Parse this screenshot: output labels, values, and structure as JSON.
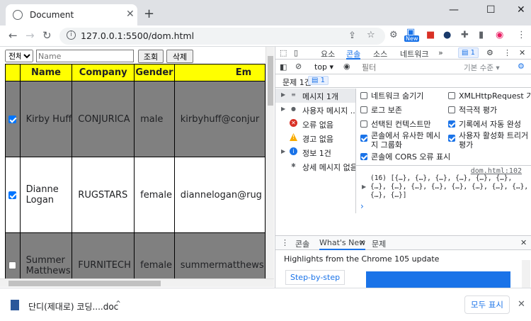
{
  "browser": {
    "tab_title": "Document",
    "tab_close": "✕",
    "new_tab": "+",
    "url": "127.0.0.1:5500/dom.html",
    "new_badge": "New",
    "window_controls": {
      "minimize": "—",
      "maximize": "☐",
      "close": "✕"
    }
  },
  "page": {
    "filter_select": "전체",
    "name_placeholder": "Name",
    "search_button": "조회",
    "delete_button": "삭제",
    "table": {
      "headers": [
        "",
        "Name",
        "Company",
        "Gender",
        "Em"
      ],
      "rows": [
        {
          "checked": true,
          "name": "Kirby Huff",
          "company": "CONJURICA",
          "gender": "male",
          "email": "kirbyhuff@conjur",
          "style": "gray"
        },
        {
          "checked": true,
          "name": "Dianne Logan",
          "company": "RUGSTARS",
          "gender": "female",
          "email": "diannelogan@rug",
          "style": "white"
        },
        {
          "checked": false,
          "name": "Summer Matthews",
          "company": "FURNITECH",
          "gender": "female",
          "email": "summermatthews",
          "style": "gray"
        }
      ]
    }
  },
  "devtools": {
    "tabs": [
      "요소",
      "콘솔",
      "소스",
      "네트워크",
      "»"
    ],
    "active_tab": "콘솔",
    "issue_count": "1",
    "context": "top ▾",
    "filter_placeholder": "필터",
    "level": "기본 수준 ▾",
    "issues_label": "문제 1건:",
    "issues_badge": "1",
    "sidebar": [
      {
        "label": "메시지 1개",
        "icon": "list-icon",
        "color": "#5f6368",
        "glyph": "≡"
      },
      {
        "label": "사용자 메시지 ...",
        "icon": "user-icon",
        "color": "#5f6368",
        "glyph": "●"
      },
      {
        "label": "오류 없음",
        "icon": "error-icon",
        "color": "#d93025",
        "glyph": "✕"
      },
      {
        "label": "경고 없음",
        "icon": "warning-icon",
        "color": "#f9ab00",
        "glyph": "!"
      },
      {
        "label": "정보 1건",
        "icon": "info-icon",
        "color": "#1a73e8",
        "glyph": "i"
      },
      {
        "label": "상세 메시지 없음",
        "icon": "bug-icon",
        "color": "#5f6368",
        "glyph": "✱"
      }
    ],
    "settings_left": [
      {
        "label": "네트워크 숨기기",
        "checked": false
      },
      {
        "label": "로그 보존",
        "checked": false
      },
      {
        "label": "선택된 컨텍스트만",
        "checked": false
      },
      {
        "label": "콘솔에서 유사한 메시\n지 그룹화",
        "checked": true
      },
      {
        "label": "콘솔에 CORS 오류 표시",
        "checked": true
      }
    ],
    "settings_right": [
      {
        "label": "XMLHttpRequest 기록",
        "checked": false
      },
      {
        "label": "적극적 평가",
        "checked": false
      },
      {
        "label": "기록에서 자동 완성",
        "checked": true
      },
      {
        "label": "사용자 활성화 트리거\n평가",
        "checked": true
      }
    ],
    "console_source": "dom.html:102",
    "console_log": "(16) [{…}, {…}, {…}, {…}, {…}, {…}, {…}, {…}, {…}, {…}, {…}, {…}, {…}, {…}, {…}, {…}]",
    "prompt": "›",
    "drawer_tabs": [
      "콘솔",
      "What's New",
      "문제"
    ],
    "drawer_active": "What's New",
    "drawer_close": "✕",
    "highlights": "Highlights from the Chrome 105 update",
    "step_button": "Step-by-step"
  },
  "download": {
    "filename": "단디(제대로) 코딩....doc",
    "show_all": "모두 표시",
    "close": "✕"
  }
}
